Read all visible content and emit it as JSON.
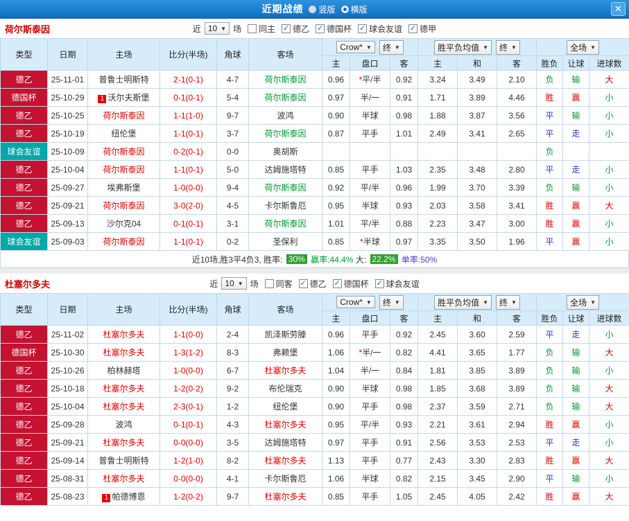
{
  "titlebar": {
    "title": "近期战绩",
    "layout_options": [
      {
        "label": "竖版",
        "selected": false
      },
      {
        "label": "横版",
        "selected": true
      }
    ],
    "close_label": "✕"
  },
  "sections": [
    {
      "team": "荷尔斯泰因",
      "filters": {
        "near_label": "近",
        "count": "10",
        "games_label": "场",
        "checkboxes": [
          {
            "label": "同主",
            "checked": false
          },
          {
            "label": "德乙",
            "checked": true
          },
          {
            "label": "德国杯",
            "checked": true
          },
          {
            "label": "球会友谊",
            "checked": true
          },
          {
            "label": "德甲",
            "checked": true
          }
        ]
      },
      "header": {
        "cols": [
          "类型",
          "日期",
          "主场",
          "比分(半场)",
          "角球",
          "客场"
        ],
        "odds_company": "Crow*",
        "odds_final": "终",
        "avg_label": "胜平负均值",
        "avg_final": "终",
        "scope": "全场",
        "sub_cols": [
          "主",
          "盘口",
          "客",
          "主",
          "和",
          "客",
          "胜负",
          "让球",
          "进球数"
        ]
      },
      "rows": [
        {
          "type": "德乙",
          "type_bg": "#c41230",
          "date": "25-11-01",
          "home": "普鲁士明斯特",
          "home_color": "#333333",
          "home_badge": "",
          "score": "2-1(0-1)",
          "corner": "4-7",
          "away": "荷尔斯泰因",
          "away_color": "#009933",
          "away_badge": "",
          "odds": [
            "0.96",
            "*平/半",
            "0.92"
          ],
          "avg": [
            "3.24",
            "3.49",
            "2.10"
          ],
          "outcome": [
            "负",
            "输",
            "大"
          ],
          "outcome_colors": [
            "#009933",
            "#009933",
            "#e60000"
          ]
        },
        {
          "type": "德国杯",
          "type_bg": "#c41230",
          "date": "25-10-29",
          "home": "沃尔夫斯堡",
          "home_color": "#333333",
          "home_badge": "1",
          "score": "0-1(0-1)",
          "corner": "5-4",
          "away": "荷尔斯泰因",
          "away_color": "#009933",
          "away_badge": "",
          "odds": [
            "0.97",
            "半/一",
            "0.91"
          ],
          "avg": [
            "1.71",
            "3.89",
            "4.46"
          ],
          "outcome": [
            "胜",
            "赢",
            "小"
          ],
          "outcome_colors": [
            "#e60000",
            "#e60000",
            "#009933"
          ]
        },
        {
          "type": "德乙",
          "type_bg": "#c41230",
          "date": "25-10-25",
          "home": "荷尔斯泰因",
          "home_color": "#e60000",
          "home_badge": "",
          "score": "1-1(1-0)",
          "corner": "9-7",
          "away": "波鸿",
          "away_color": "#333333",
          "away_badge": "",
          "odds": [
            "0.90",
            "半球",
            "0.98"
          ],
          "avg": [
            "1.88",
            "3.87",
            "3.56"
          ],
          "outcome": [
            "平",
            "输",
            "小"
          ],
          "outcome_colors": [
            "#3333cc",
            "#009933",
            "#009933"
          ]
        },
        {
          "type": "德乙",
          "type_bg": "#c41230",
          "date": "25-10-19",
          "home": "纽伦堡",
          "home_color": "#333333",
          "home_badge": "",
          "score": "1-1(0-1)",
          "corner": "3-7",
          "away": "荷尔斯泰因",
          "away_color": "#009933",
          "away_badge": "",
          "odds": [
            "0.87",
            "平手",
            "1.01"
          ],
          "avg": [
            "2.49",
            "3.41",
            "2.65"
          ],
          "outcome": [
            "平",
            "走",
            "小"
          ],
          "outcome_colors": [
            "#3333cc",
            "#3333cc",
            "#009933"
          ]
        },
        {
          "type": "球会友谊",
          "type_bg": "#00a8a8",
          "date": "25-10-09",
          "home": "荷尔斯泰因",
          "home_color": "#e60000",
          "home_badge": "",
          "score": "0-2(0-1)",
          "corner": "0-0",
          "away": "奥胡斯",
          "away_color": "#333333",
          "away_badge": "",
          "odds": [
            "",
            "",
            ""
          ],
          "avg": [
            "",
            "",
            ""
          ],
          "outcome": [
            "负",
            "",
            ""
          ],
          "outcome_colors": [
            "#009933",
            "",
            ""
          ]
        },
        {
          "type": "德乙",
          "type_bg": "#c41230",
          "date": "25-10-04",
          "home": "荷尔斯泰因",
          "home_color": "#e60000",
          "home_badge": "",
          "score": "1-1(0-1)",
          "corner": "5-0",
          "away": "达姆施塔特",
          "away_color": "#333333",
          "away_badge": "",
          "odds": [
            "0.85",
            "平手",
            "1.03"
          ],
          "avg": [
            "2.35",
            "3.48",
            "2.80"
          ],
          "outcome": [
            "平",
            "走",
            "小"
          ],
          "outcome_colors": [
            "#3333cc",
            "#3333cc",
            "#009933"
          ]
        },
        {
          "type": "德乙",
          "type_bg": "#c41230",
          "date": "25-09-27",
          "home": "埃弗斯堡",
          "home_color": "#333333",
          "home_badge": "",
          "score": "1-0(0-0)",
          "corner": "9-4",
          "away": "荷尔斯泰因",
          "away_color": "#009933",
          "away_badge": "",
          "odds": [
            "0.92",
            "平/半",
            "0.96"
          ],
          "avg": [
            "1.99",
            "3.70",
            "3.39"
          ],
          "outcome": [
            "负",
            "输",
            "小"
          ],
          "outcome_colors": [
            "#009933",
            "#009933",
            "#009933"
          ]
        },
        {
          "type": "德乙",
          "type_bg": "#c41230",
          "date": "25-09-21",
          "home": "荷尔斯泰因",
          "home_color": "#e60000",
          "home_badge": "",
          "score": "3-0(2-0)",
          "corner": "4-5",
          "away": "卡尔斯鲁厄",
          "away_color": "#333333",
          "away_badge": "",
          "odds": [
            "0.95",
            "半球",
            "0.93"
          ],
          "avg": [
            "2.03",
            "3.58",
            "3.41"
          ],
          "outcome": [
            "胜",
            "赢",
            "大"
          ],
          "outcome_colors": [
            "#e60000",
            "#e60000",
            "#e60000"
          ]
        },
        {
          "type": "德乙",
          "type_bg": "#c41230",
          "date": "25-09-13",
          "home": "沙尔克04",
          "home_color": "#333333",
          "home_badge": "",
          "score": "0-1(0-1)",
          "corner": "3-1",
          "away": "荷尔斯泰因",
          "away_color": "#009933",
          "away_badge": "",
          "odds": [
            "1.01",
            "平/半",
            "0.88"
          ],
          "avg": [
            "2.23",
            "3.47",
            "3.00"
          ],
          "outcome": [
            "胜",
            "赢",
            "小"
          ],
          "outcome_colors": [
            "#e60000",
            "#e60000",
            "#009933"
          ]
        },
        {
          "type": "球会友谊",
          "type_bg": "#00a8a8",
          "date": "25-09-03",
          "home": "荷尔斯泰因",
          "home_color": "#e60000",
          "home_badge": "",
          "score": "1-1(0-1)",
          "corner": "0-2",
          "away": "圣保利",
          "away_color": "#333333",
          "away_badge": "",
          "odds": [
            "0.85",
            "*半球",
            "0.97"
          ],
          "avg": [
            "3.35",
            "3.50",
            "1.96"
          ],
          "outcome": [
            "平",
            "赢",
            "小"
          ],
          "outcome_colors": [
            "#3333cc",
            "#e60000",
            "#009933"
          ]
        }
      ],
      "summary": [
        {
          "text": "近10场,胜3平4负3, 胜率: ",
          "color": "#333333"
        },
        {
          "text": "30%",
          "color": "#ffffff",
          "bg": "#2f9e2f"
        },
        {
          "text": " 赢率:44.4%",
          "color": "#009933"
        },
        {
          "text": " 大: ",
          "color": "#333333"
        },
        {
          "text": "22.2%",
          "color": "#ffffff",
          "bg": "#2f9e2f"
        },
        {
          "text": " 单率:50%",
          "color": "#4a3ad0"
        }
      ]
    },
    {
      "team": "杜塞尔多夫",
      "filters": {
        "near_label": "近",
        "count": "10",
        "games_label": "场",
        "checkboxes": [
          {
            "label": "同客",
            "checked": false
          },
          {
            "label": "德乙",
            "checked": true
          },
          {
            "label": "德国杯",
            "checked": true
          },
          {
            "label": "球会友谊",
            "checked": true
          }
        ]
      },
      "header": {
        "cols": [
          "类型",
          "日期",
          "主场",
          "比分(半场)",
          "角球",
          "客场"
        ],
        "odds_company": "Crow*",
        "odds_final": "终",
        "avg_label": "胜平负均值",
        "avg_final": "终",
        "scope": "全场",
        "sub_cols": [
          "主",
          "盘口",
          "客",
          "主",
          "和",
          "客",
          "胜负",
          "让球",
          "进球数"
        ]
      },
      "rows": [
        {
          "type": "德乙",
          "type_bg": "#c41230",
          "date": "25-11-02",
          "home": "杜塞尔多夫",
          "home_color": "#e60000",
          "home_badge": "",
          "score": "1-1(0-0)",
          "corner": "2-4",
          "away": "凯泽斯劳滕",
          "away_color": "#333333",
          "away_badge": "",
          "odds": [
            "0.96",
            "平手",
            "0.92"
          ],
          "avg": [
            "2.45",
            "3.60",
            "2.59"
          ],
          "outcome": [
            "平",
            "走",
            "小"
          ],
          "outcome_colors": [
            "#3333cc",
            "#3333cc",
            "#009933"
          ]
        },
        {
          "type": "德国杯",
          "type_bg": "#c41230",
          "date": "25-10-30",
          "home": "杜塞尔多夫",
          "home_color": "#e60000",
          "home_badge": "",
          "score": "1-3(1-2)",
          "corner": "8-3",
          "away": "弗赖堡",
          "away_color": "#333333",
          "away_badge": "",
          "odds": [
            "1.06",
            "*半/一",
            "0.82"
          ],
          "avg": [
            "4.41",
            "3.65",
            "1.77"
          ],
          "outcome": [
            "负",
            "输",
            "大"
          ],
          "outcome_colors": [
            "#009933",
            "#009933",
            "#e60000"
          ]
        },
        {
          "type": "德乙",
          "type_bg": "#c41230",
          "date": "25-10-26",
          "home": "柏林赫塔",
          "home_color": "#333333",
          "home_badge": "",
          "score": "1-0(0-0)",
          "corner": "6-7",
          "away": "杜塞尔多夫",
          "away_color": "#e60000",
          "away_badge": "",
          "odds": [
            "1.04",
            "半/一",
            "0.84"
          ],
          "avg": [
            "1.81",
            "3.85",
            "3.89"
          ],
          "outcome": [
            "负",
            "输",
            "小"
          ],
          "outcome_colors": [
            "#009933",
            "#009933",
            "#009933"
          ]
        },
        {
          "type": "德乙",
          "type_bg": "#c41230",
          "date": "25-10-18",
          "home": "杜塞尔多夫",
          "home_color": "#e60000",
          "home_badge": "",
          "score": "1-2(0-2)",
          "corner": "9-2",
          "away": "布伦瑞克",
          "away_color": "#333333",
          "away_badge": "",
          "odds": [
            "0.90",
            "半球",
            "0.98"
          ],
          "avg": [
            "1.85",
            "3.68",
            "3.89"
          ],
          "outcome": [
            "负",
            "输",
            "大"
          ],
          "outcome_colors": [
            "#009933",
            "#009933",
            "#e60000"
          ]
        },
        {
          "type": "德乙",
          "type_bg": "#c41230",
          "date": "25-10-04",
          "home": "杜塞尔多夫",
          "home_color": "#e60000",
          "home_badge": "",
          "score": "2-3(0-1)",
          "corner": "1-2",
          "away": "纽伦堡",
          "away_color": "#333333",
          "away_badge": "",
          "odds": [
            "0.90",
            "平手",
            "0.98"
          ],
          "avg": [
            "2.37",
            "3.59",
            "2.71"
          ],
          "outcome": [
            "负",
            "输",
            "大"
          ],
          "outcome_colors": [
            "#009933",
            "#009933",
            "#e60000"
          ]
        },
        {
          "type": "德乙",
          "type_bg": "#c41230",
          "date": "25-09-28",
          "home": "波鸿",
          "home_color": "#333333",
          "home_badge": "",
          "score": "0-1(0-1)",
          "corner": "4-3",
          "away": "杜塞尔多夫",
          "away_color": "#e60000",
          "away_badge": "",
          "odds": [
            "0.95",
            "平/半",
            "0.93"
          ],
          "avg": [
            "2.21",
            "3.61",
            "2.94"
          ],
          "outcome": [
            "胜",
            "赢",
            "小"
          ],
          "outcome_colors": [
            "#e60000",
            "#e60000",
            "#009933"
          ]
        },
        {
          "type": "德乙",
          "type_bg": "#c41230",
          "date": "25-09-21",
          "home": "杜塞尔多夫",
          "home_color": "#e60000",
          "home_badge": "",
          "score": "0-0(0-0)",
          "corner": "3-5",
          "away": "达姆施塔特",
          "away_color": "#333333",
          "away_badge": "",
          "odds": [
            "0.97",
            "平手",
            "0.91"
          ],
          "avg": [
            "2.56",
            "3.53",
            "2.53"
          ],
          "outcome": [
            "平",
            "走",
            "小"
          ],
          "outcome_colors": [
            "#3333cc",
            "#3333cc",
            "#009933"
          ]
        },
        {
          "type": "德乙",
          "type_bg": "#c41230",
          "date": "25-09-14",
          "home": "普鲁士明斯特",
          "home_color": "#333333",
          "home_badge": "",
          "score": "1-2(1-0)",
          "corner": "8-2",
          "away": "杜塞尔多夫",
          "away_color": "#e60000",
          "away_badge": "",
          "odds": [
            "1.13",
            "平手",
            "0.77"
          ],
          "avg": [
            "2.43",
            "3.30",
            "2.83"
          ],
          "outcome": [
            "胜",
            "赢",
            "大"
          ],
          "outcome_colors": [
            "#e60000",
            "#e60000",
            "#e60000"
          ]
        },
        {
          "type": "德乙",
          "type_bg": "#c41230",
          "date": "25-08-31",
          "home": "杜塞尔多夫",
          "home_color": "#e60000",
          "home_badge": "",
          "score": "0-0(0-0)",
          "corner": "4-1",
          "away": "卡尔斯鲁厄",
          "away_color": "#333333",
          "away_badge": "",
          "odds": [
            "1.06",
            "半球",
            "0.82"
          ],
          "avg": [
            "2.15",
            "3.45",
            "2.90"
          ],
          "outcome": [
            "平",
            "输",
            "小"
          ],
          "outcome_colors": [
            "#3333cc",
            "#009933",
            "#009933"
          ]
        },
        {
          "type": "德乙",
          "type_bg": "#c41230",
          "date": "25-08-23",
          "home": "帕德博恩",
          "home_color": "#333333",
          "home_badge": "1",
          "score": "1-2(0-2)",
          "corner": "9-7",
          "away": "杜塞尔多夫",
          "away_color": "#e60000",
          "away_badge": "",
          "odds": [
            "0.85",
            "平手",
            "1.05"
          ],
          "avg": [
            "2.45",
            "4.05",
            "2.42"
          ],
          "outcome": [
            "胜",
            "赢",
            "大"
          ],
          "outcome_colors": [
            "#e60000",
            "#e60000",
            "#e60000"
          ]
        }
      ],
      "summary": []
    }
  ]
}
